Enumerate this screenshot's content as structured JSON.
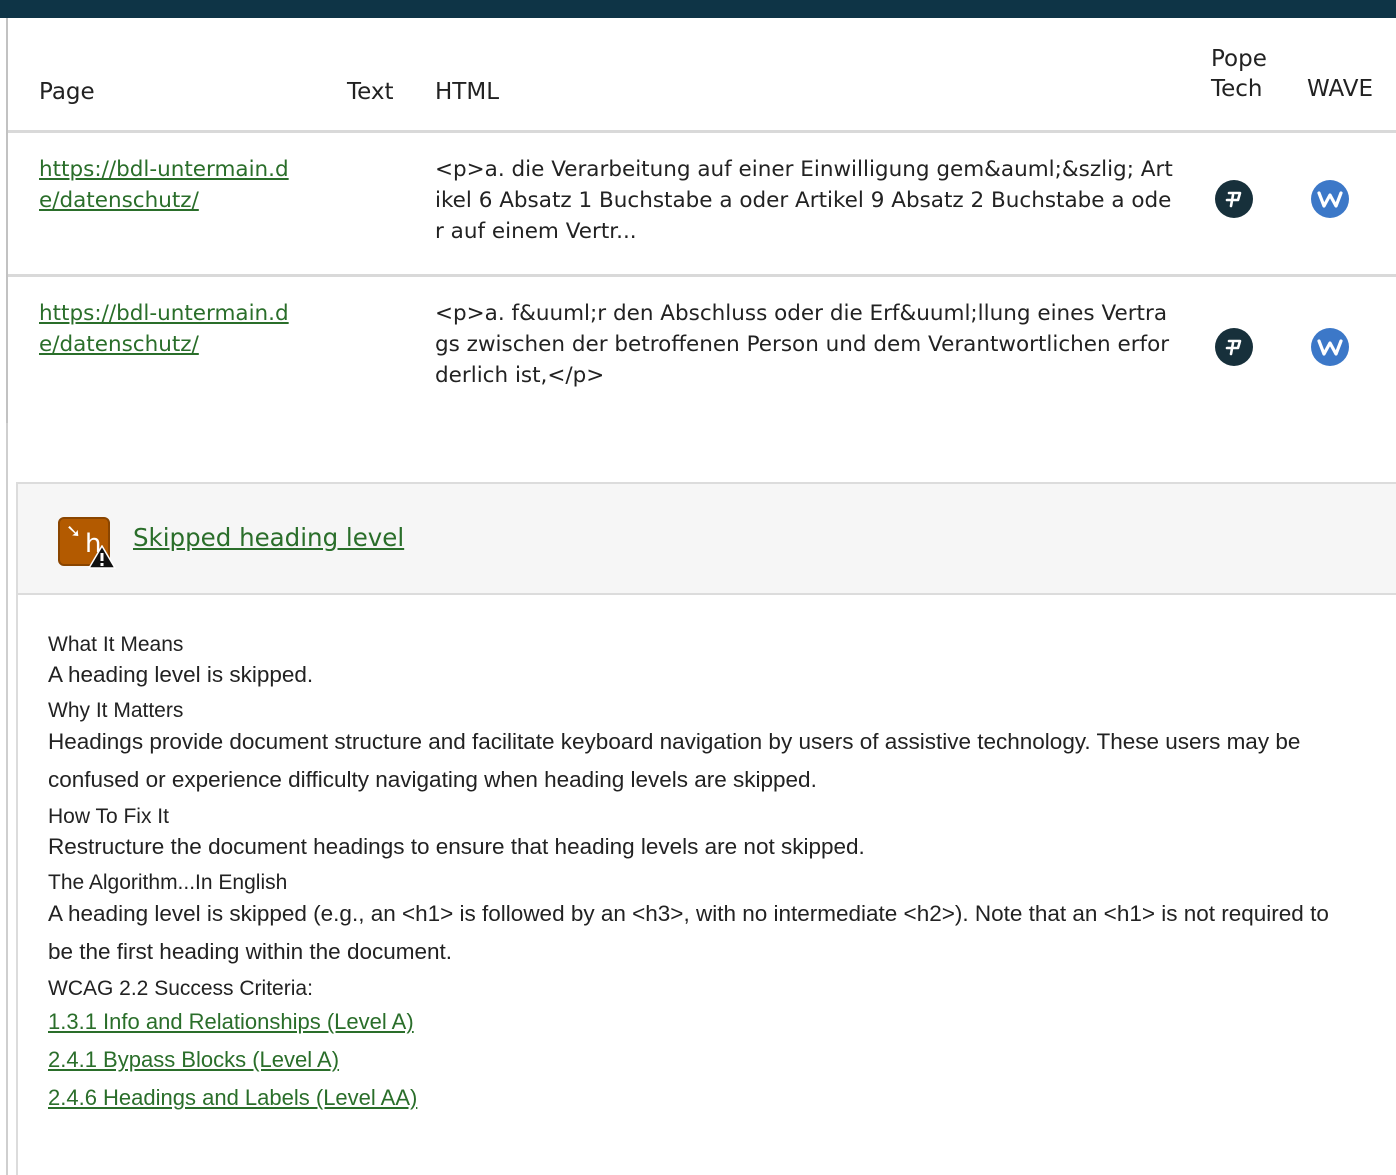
{
  "table": {
    "headers": {
      "page": "Page",
      "text": "Text",
      "html": "HTML",
      "pope_tech": "Pope Tech",
      "wave": "WAVE"
    },
    "rows": [
      {
        "page_url": "https://bdl-untermain.de/datenschutz/",
        "text": "",
        "html": "<p>a. die Verarbeitung auf einer Einwilligung gem&auml;&szlig; Artikel 6 Absatz 1 Buchstabe a oder Artikel 9 Absatz 2 Buchstabe a oder auf einem Vertr..."
      },
      {
        "page_url": "https://bdl-untermain.de/datenschutz/",
        "text": "",
        "html": "<p>a. f&uuml;r den Abschluss oder die Erf&uuml;llung eines Vertrags zwischen der betroffenen Person und dem Verantwortlichen erforderlich ist,</p>"
      }
    ],
    "icons": {
      "pope_tech": "pope-tech-logo-icon",
      "wave": "wave-logo-icon"
    }
  },
  "issue": {
    "title": "Skipped heading level",
    "icon": "skipped-heading-warning-icon",
    "what_it_means_heading": "What It Means",
    "what_it_means_text": "A heading level is skipped.",
    "why_it_matters_heading": "Why It Matters",
    "why_it_matters_text": "Headings provide document structure and facilitate keyboard navigation by users of assistive technology. These users may be confused or experience difficulty navigating when heading levels are skipped.",
    "how_to_fix_heading": "How To Fix It",
    "how_to_fix_text": "Restructure the document headings to ensure that heading levels are not skipped.",
    "algorithm_heading": "The Algorithm...In English",
    "algorithm_text": "A heading level is skipped (e.g., an <h1> is followed by an <h3>, with no intermediate <h2>). Note that an <h1> is not required to be the first heading within the document.",
    "wcag_heading": "WCAG 2.2 Success Criteria:",
    "wcag_links": [
      "1.3.1 Info and Relationships (Level A) ",
      "2.4.1 Bypass Blocks (Level A) ",
      "2.4.6 Headings and Labels (Level AA) "
    ]
  },
  "colors": {
    "topbar": "#0e3446",
    "link_green": "#2a6e2a",
    "warning_orange": "#b35a00",
    "wave_blue": "#3c78c8",
    "pope_dark": "#17303b"
  }
}
